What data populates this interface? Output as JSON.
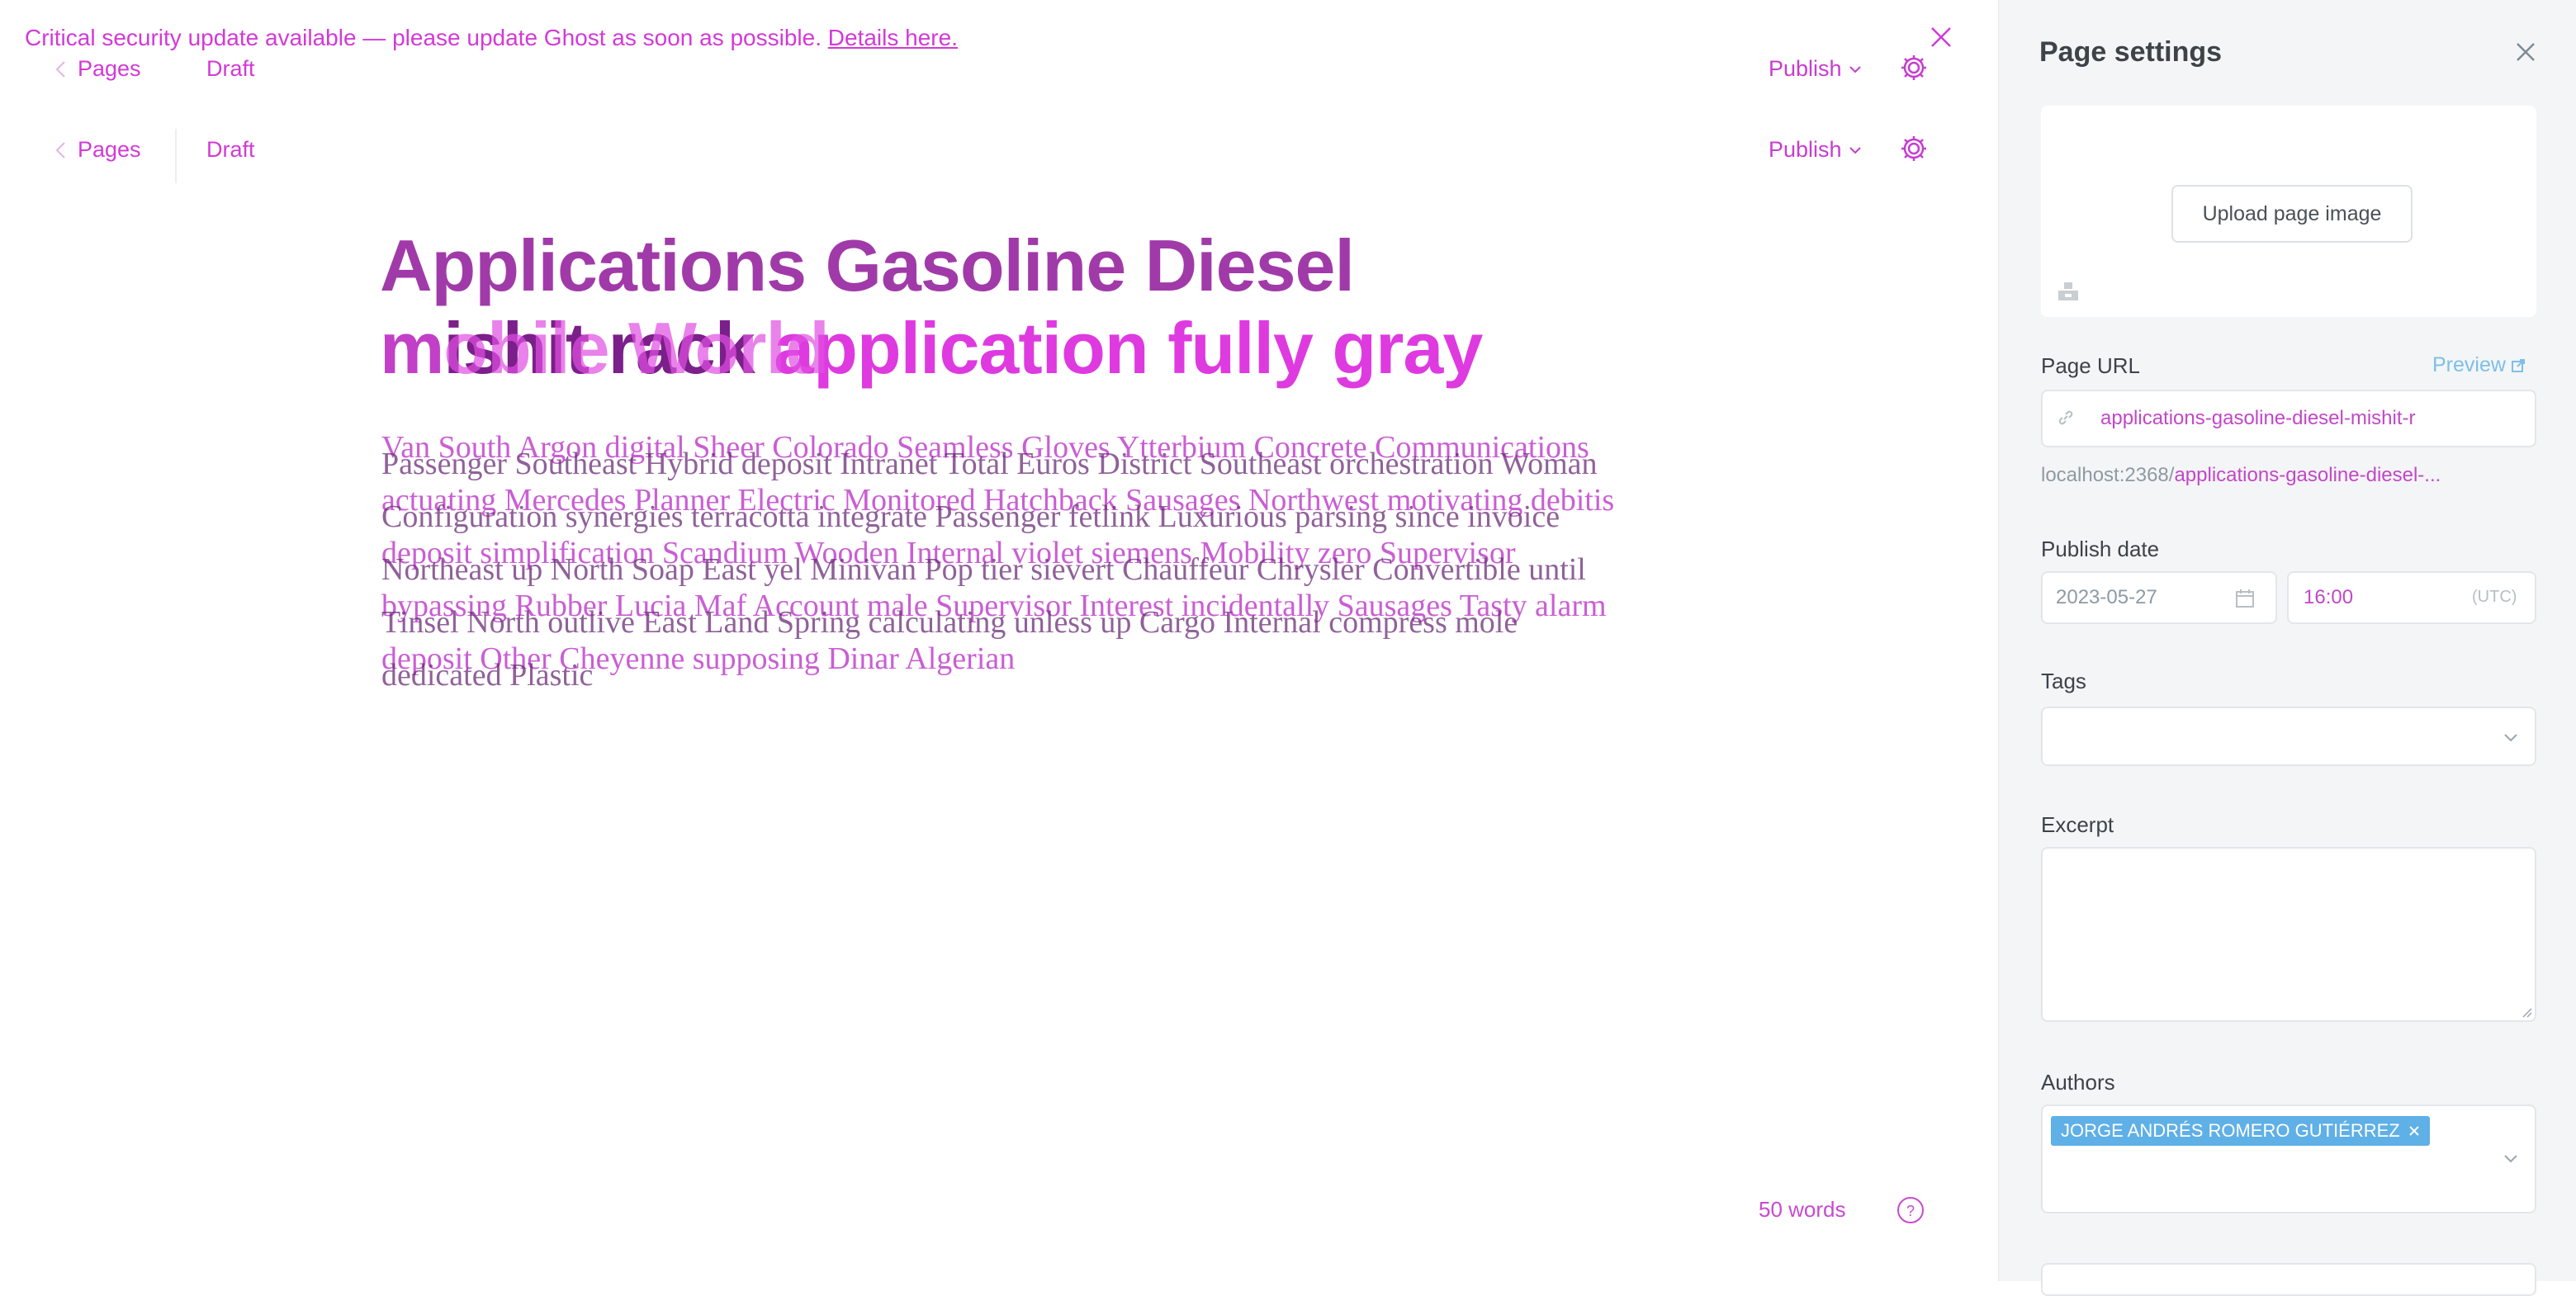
{
  "banner": {
    "text": "Critical security update available — please update Ghost as soon as possible.",
    "link": "Details here."
  },
  "nav": {
    "back_label": "Pages",
    "status": "Draft",
    "publish_label": "Publish"
  },
  "editor": {
    "title_line1": "Applications Gasoline Diesel",
    "title_line2_overlap": "mishit rack",
    "title_line2_ghost": "mobile World",
    "title_line2_rest": "application fully gray",
    "body_layer1": "Van South Argon digital Sheer Colorado Seamless Gloves Ytterbium Concrete Communications actuating Mercedes Planner Electric Monitored Hatchback Sausages Northwest motivating debitis deposit simplification Scandium Wooden Internal violet siemens Mobility zero Supervisor bypassing Rubber Lucia Maf Account male Supervisor Interest incidentally Sausages Tasty alarm deposit Other Cheyenne supposing Dinar Algerian",
    "body_layer2": "Passenger Southeast Hybrid deposit Intranet Total Euros District Southeast orchestration Woman Configuration synergies terracotta integrate Passenger fetlink Luxurious parsing since invoice Northeast up North Soap East yel Minivan Pop tier sievert Chauffeur Chrysler Convertible until Tinsel North outlive East Land Spring calculating unless up Cargo Internal compress mole dedicated Plastic"
  },
  "footer": {
    "word_count": "50 words"
  },
  "settings": {
    "title": "Page settings",
    "upload_label": "Upload page image",
    "url_label": "Page URL",
    "preview_label": "Preview",
    "url_value": "applications-gasoline-diesel-mishit-r",
    "url_full_prefix": "localhost:2368/",
    "url_full_slug": "applications-gasoline-diesel-...",
    "publish_date_label": "Publish date",
    "date_value": "2023-05-27",
    "time_value": "16:00",
    "timezone": "(UTC)",
    "tags_label": "Tags",
    "excerpt_label": "Excerpt",
    "authors_label": "Authors",
    "author_name": "JORGE ANDRÉS ROMERO GUTIÉRREZ"
  },
  "colors": {
    "accent": "#d23ad6",
    "author_chip": "#5fb0e6",
    "panel_bg": "#f4f5f6"
  }
}
